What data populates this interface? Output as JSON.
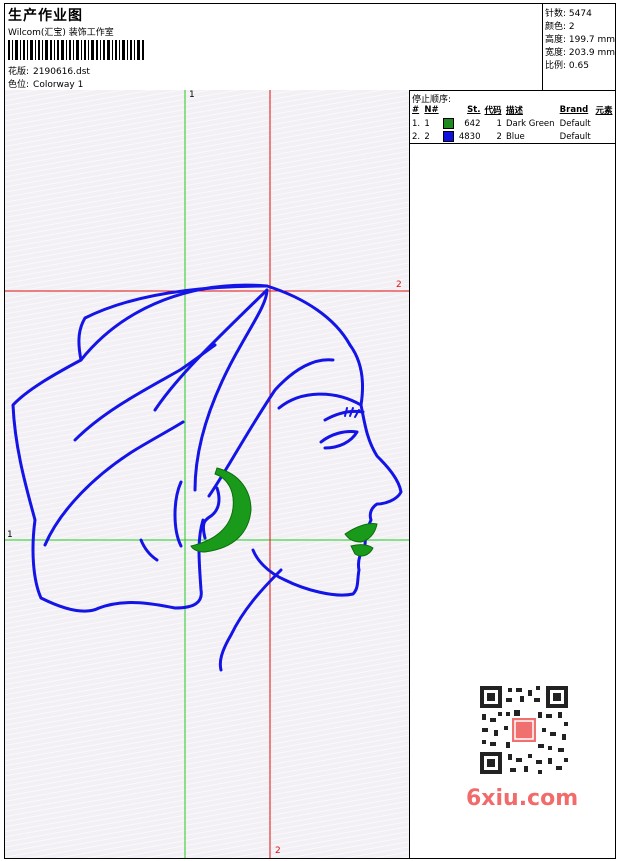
{
  "header": {
    "title": "生产作业图",
    "company": "Wilcom(汇宝) 装饰工作室",
    "design_label": "花版:",
    "design_value": "2190616.dst",
    "colorway_label": "色位:",
    "colorway_value": "Colorway 1"
  },
  "stats": {
    "stitches": "针数: 5474",
    "colors": "颜色: 2",
    "height": "高度: 199.7 mm",
    "width": "宽度: 203.9 mm",
    "scale": "比例: 0.65"
  },
  "guides": {
    "green_v_label": "1",
    "green_h_label": "1",
    "red_v_label": "2",
    "red_h_label": "2"
  },
  "stop_sequence": {
    "title": "停止顺序:",
    "columns": [
      "#",
      "N#",
      "St.",
      "代码",
      "描述",
      "Brand",
      "元素"
    ],
    "rows": [
      {
        "index": "1.",
        "needle": "1",
        "color": "#1f8a1f",
        "stitches": "642",
        "code": "1",
        "description": "Dark Green",
        "brand": "Default",
        "element": ""
      },
      {
        "index": "2.",
        "needle": "2",
        "color": "#1010e0",
        "stitches": "4830",
        "code": "2",
        "description": "Blue",
        "brand": "Default",
        "element": ""
      }
    ]
  },
  "watermark": {
    "text": "6xiu.com"
  },
  "colors": {
    "blue_thread": "#1414e6",
    "green_thread": "#1a9a1a",
    "guide_green": "#22cc22",
    "guide_red": "#dd1111"
  }
}
